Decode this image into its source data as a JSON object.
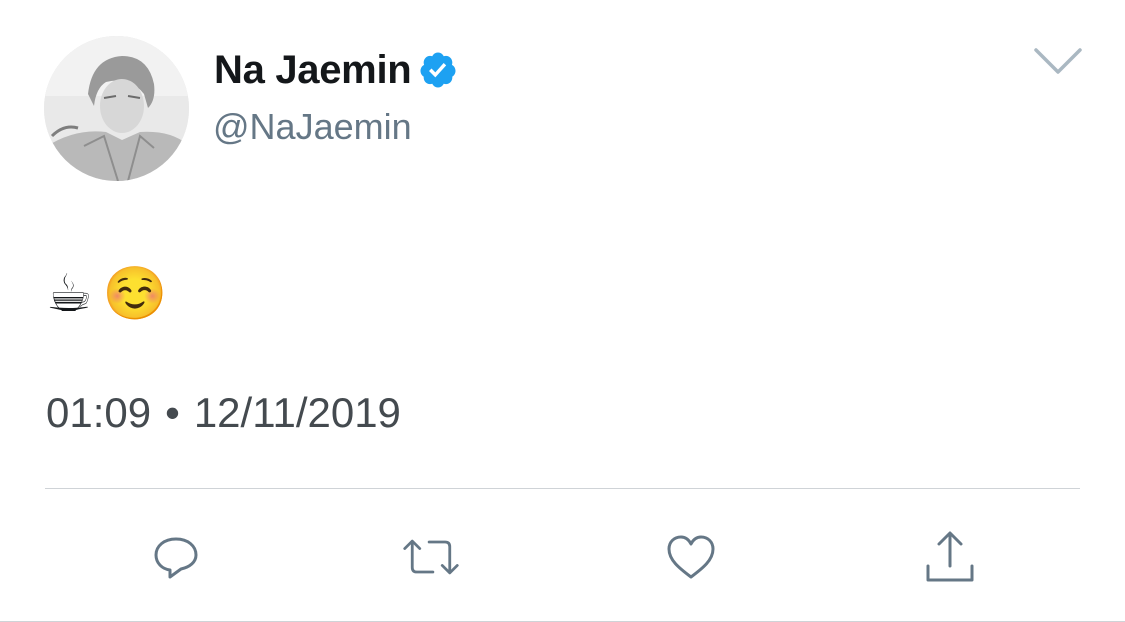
{
  "author": {
    "display_name": "Na Jaemin",
    "handle": "@NaJaemin",
    "verified": true,
    "verified_color": "#1da1f2"
  },
  "tweet": {
    "text_emojis": [
      "☕",
      "☺️"
    ]
  },
  "meta": {
    "time": "01:09",
    "separator": "•",
    "date": "12/11/2019"
  },
  "actions": [
    {
      "icon": "reply-icon"
    },
    {
      "icon": "retweet-icon"
    },
    {
      "icon": "like-icon"
    },
    {
      "icon": "share-icon"
    }
  ],
  "colors": {
    "name": "#14171a",
    "secondary": "#657786",
    "timestamp": "#444a4f",
    "divider": "#cfd3d7"
  }
}
